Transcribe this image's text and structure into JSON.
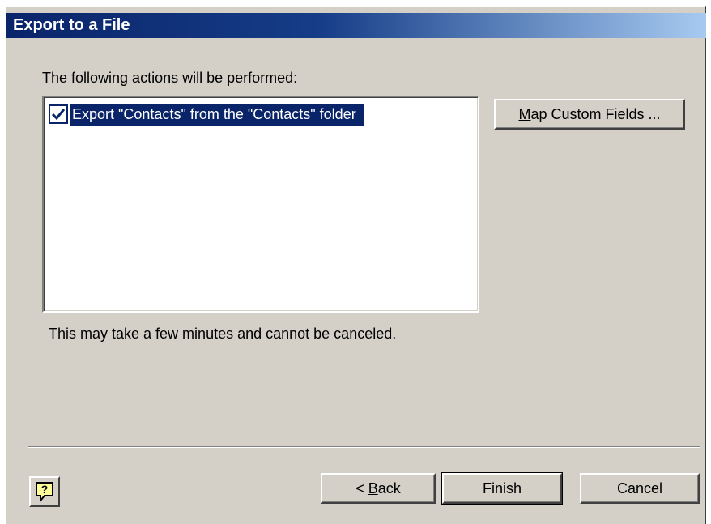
{
  "window": {
    "title": "Export to a File"
  },
  "main": {
    "actions_label": "The following actions will be performed:",
    "actions": [
      {
        "label": "Export \"Contacts\" from the \"Contacts\" folder",
        "checked": true
      }
    ],
    "map_button": {
      "mnemonic": "M",
      "rest": "ap Custom Fields ..."
    },
    "note": "This may take a few minutes and cannot be canceled."
  },
  "footer": {
    "help_icon": "help-icon",
    "back": {
      "prefix": "< ",
      "mnemonic": "B",
      "rest": "ack"
    },
    "finish": "Finish",
    "cancel": "Cancel"
  },
  "colors": {
    "face": "#d4d0c8",
    "title_start": "#0a246a",
    "title_end": "#a6caf0",
    "selection": "#0a246a"
  }
}
